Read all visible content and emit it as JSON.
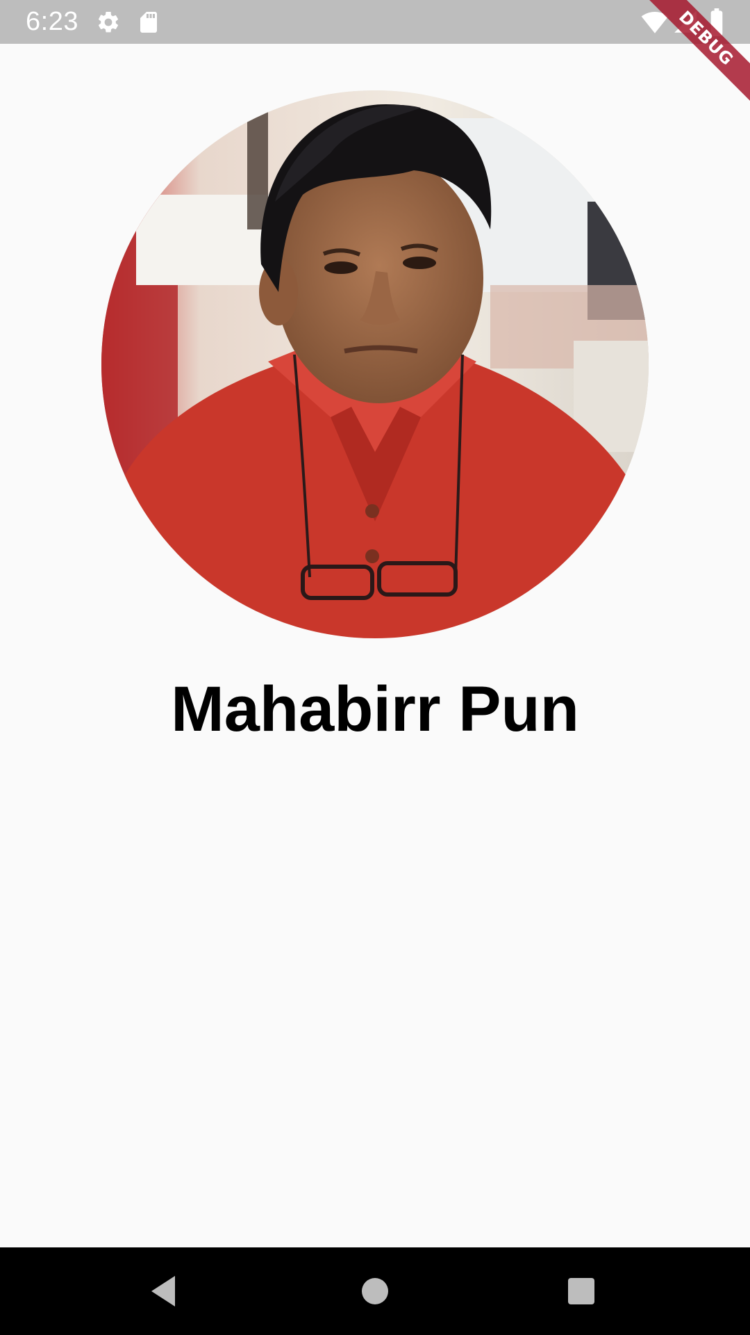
{
  "status_bar": {
    "time": "6:23",
    "left_icons": [
      "gear-icon",
      "sd-card-icon"
    ],
    "right_icons": [
      "wifi-icon",
      "signal-icon",
      "battery-icon"
    ],
    "debug_banner": "DEBUG"
  },
  "profile": {
    "avatar": "person-photo",
    "name": "Mahabirr Pun"
  },
  "nav_bar": {
    "buttons": [
      "back-icon",
      "home-icon",
      "recents-icon"
    ]
  },
  "colors": {
    "status_bar": "#bdbdbd",
    "background": "#fafafa",
    "nav_bar": "#000000",
    "debug_ribbon": "#a6192e"
  }
}
